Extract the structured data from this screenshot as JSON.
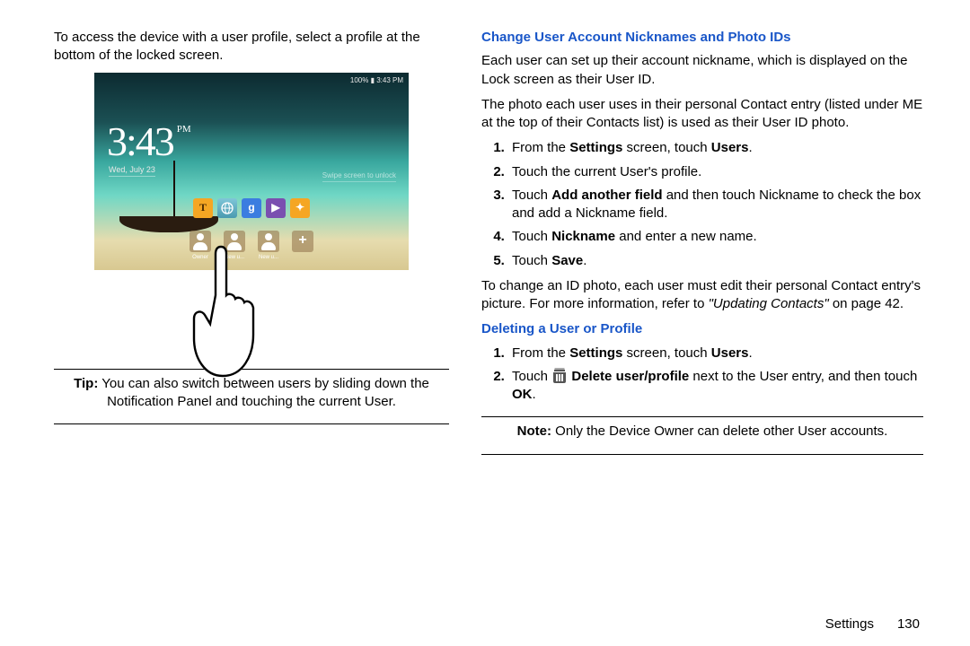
{
  "left": {
    "intro": "To access the device with a user profile, select a profile at the bottom of the locked screen.",
    "tip_label": "Tip:",
    "tip_text": " You can also switch between users by sliding down the Notification Panel and touching the current User."
  },
  "lockscreen": {
    "time": "3:43",
    "ampm": "PM",
    "date": "Wed, July 23",
    "swipe": "Swipe screen to unlock",
    "status": "100% ▮ 3:43 PM",
    "app_labels": {
      "t": "T",
      "g": "g",
      "play": "▶",
      "star": "✦"
    },
    "users": [
      "Owner",
      "New u...",
      "New u..."
    ]
  },
  "right": {
    "h1": "Change User Account Nicknames and Photo IDs",
    "p1": "Each user can set up their account nickname, which is displayed on the Lock screen as their User ID.",
    "p2": "The photo each user uses in their personal Contact entry (listed under ME at the top of their Contacts list) is used as their User ID photo.",
    "steps1": {
      "s1a": "From the ",
      "s1b": "Settings",
      "s1c": " screen, touch ",
      "s1d": "Users",
      "s1e": ".",
      "s2": "Touch the current User's profile.",
      "s3a": "Touch ",
      "s3b": "Add another field",
      "s3c": " and then touch Nickname to check the box and add a Nickname field.",
      "s4a": "Touch ",
      "s4b": "Nickname",
      "s4c": " and enter a new name.",
      "s5a": "Touch ",
      "s5b": "Save",
      "s5c": "."
    },
    "p3a": "To change an ID photo, each user must edit their personal Contact entry's picture. For more information, refer to ",
    "p3b": "\"Updating Contacts\"",
    "p3c": " on page 42.",
    "h2": "Deleting a User or Profile",
    "steps2": {
      "s1a": "From the ",
      "s1b": "Settings",
      "s1c": " screen, touch ",
      "s1d": "Users",
      "s1e": ".",
      "s2a": "Touch ",
      "s2b": "Delete user/profile",
      "s2c": " next to the User entry, and then touch ",
      "s2d": "OK",
      "s2e": "."
    },
    "note_label": "Note:",
    "note_text": " Only the Device Owner can delete other User accounts."
  },
  "footer": {
    "section": "Settings",
    "page": "130"
  }
}
